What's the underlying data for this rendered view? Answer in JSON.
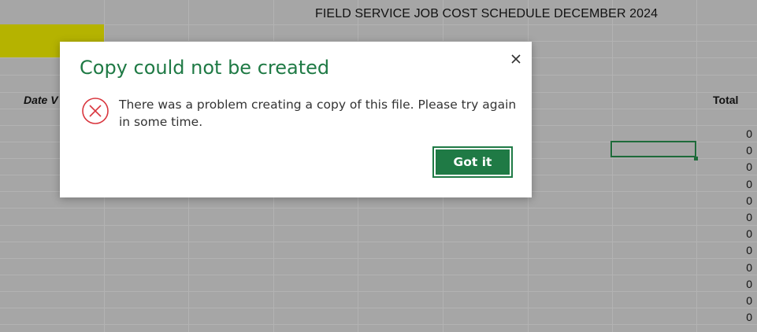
{
  "sheet": {
    "title": "FIELD SERVICE JOB COST SCHEDULE DECEMBER 2024",
    "date_header": "Date V",
    "total_header": "Total",
    "total_values": [
      "0",
      "0",
      "0",
      "0",
      "0",
      "0",
      "0",
      "0",
      "0",
      "0",
      "0",
      "0"
    ],
    "highlight_color": "#b5b300",
    "selection_color": "#1e6b3a"
  },
  "dialog": {
    "title": "Copy could not be created",
    "message": "There was a problem creating a copy of this file. Please try again in some time.",
    "button_label": "Got it",
    "close_icon": "close-icon",
    "status_icon": "error-circle-x-icon",
    "accent_color": "#1f7a45",
    "error_color": "#d9363e"
  }
}
